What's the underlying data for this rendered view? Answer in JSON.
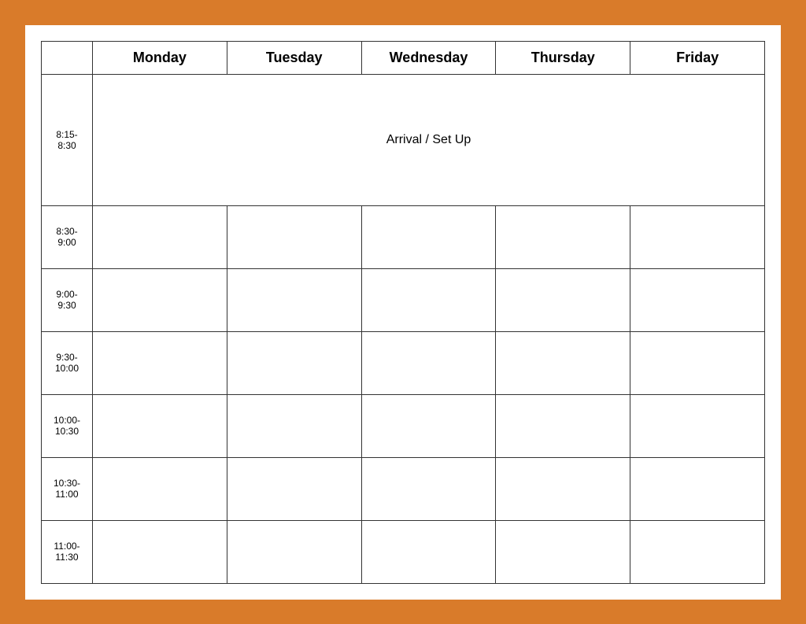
{
  "table": {
    "headers": {
      "empty": "",
      "monday": "Monday",
      "tuesday": "Tuesday",
      "wednesday": "Wednesday",
      "thursday": "Thursday",
      "friday": "Friday"
    },
    "rows": [
      {
        "time": "8:15-\n8:30",
        "arrival_text": "Arrival / Set Up",
        "is_arrival": true
      },
      {
        "time": "8:30-\n9:00",
        "is_arrival": false
      },
      {
        "time": "9:00-\n9:30",
        "is_arrival": false
      },
      {
        "time": "9:30-\n10:00",
        "is_arrival": false
      },
      {
        "time": "10:00-\n10:30",
        "is_arrival": false
      },
      {
        "time": "10:30-\n11:00",
        "is_arrival": false
      },
      {
        "time": "11:00-\n11:30",
        "is_arrival": false
      }
    ]
  }
}
